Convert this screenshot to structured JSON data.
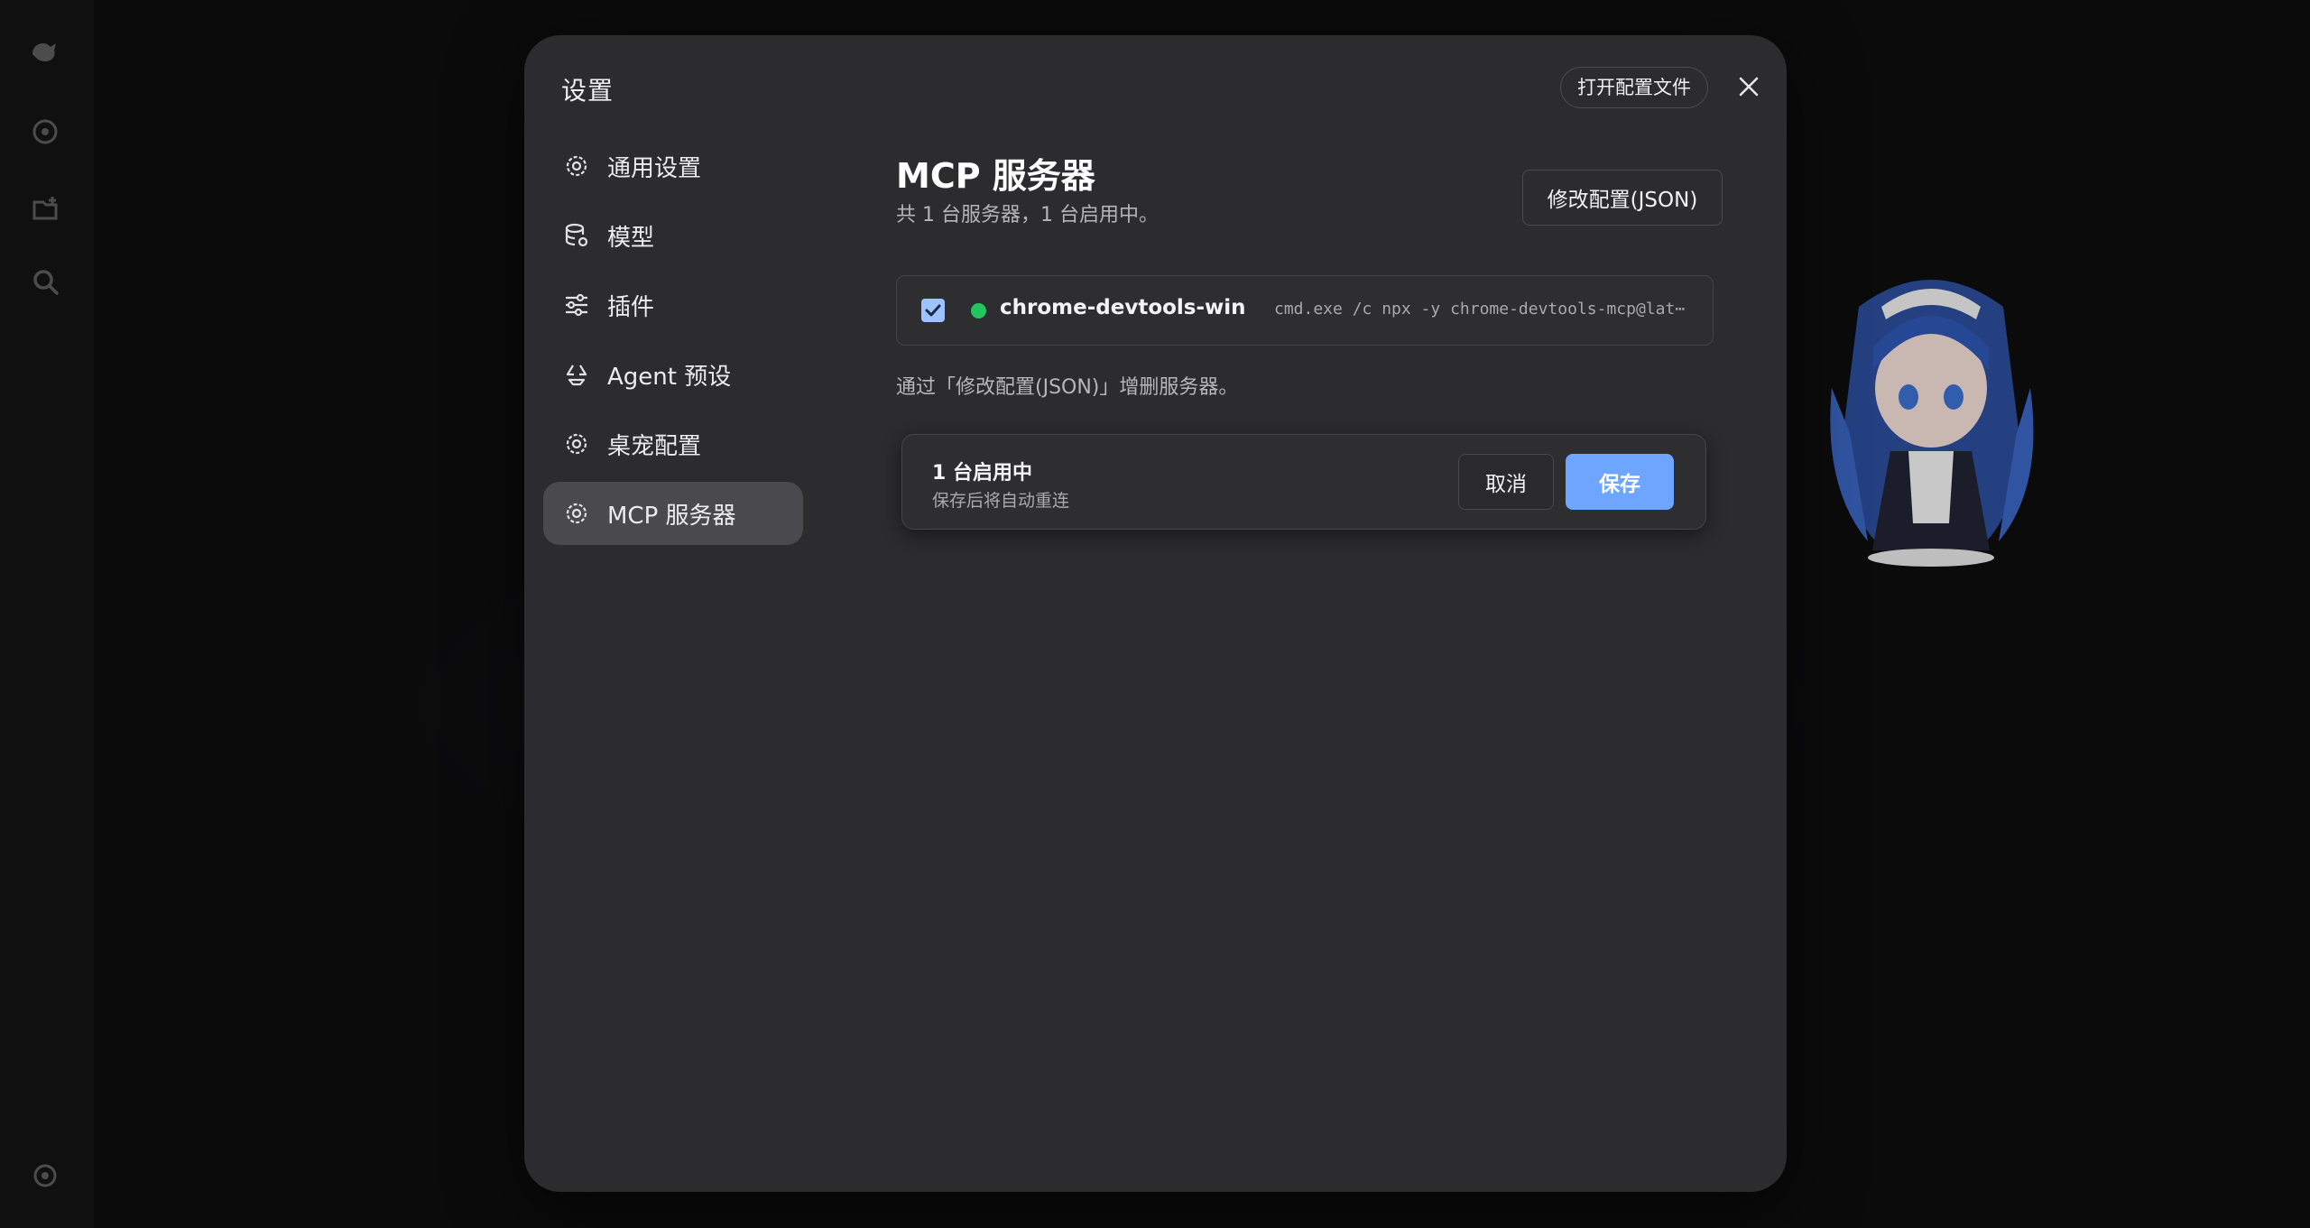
{
  "modal": {
    "title": "设置",
    "open_config_label": "打开配置文件"
  },
  "sidebar": {
    "items": [
      {
        "label": "通用设置",
        "icon": "gear-icon"
      },
      {
        "label": "模型",
        "icon": "database-icon"
      },
      {
        "label": "插件",
        "icon": "sliders-icon"
      },
      {
        "label": "Agent 预设",
        "icon": "recycle-icon"
      },
      {
        "label": "桌宠配置",
        "icon": "gear-icon"
      },
      {
        "label": "MCP 服务器",
        "icon": "gear-icon",
        "active": true
      }
    ]
  },
  "main": {
    "title": "MCP 服务器",
    "subtitle": "共 1 台服务器，1 台启用中。",
    "edit_json_label": "修改配置(JSON)",
    "servers": [
      {
        "name": "chrome-devtools-win",
        "command": "cmd.exe /c npx -y chrome-devtools-mcp@lat⋯",
        "enabled": true,
        "status_color": "#22c55e"
      }
    ],
    "hint": "通过「修改配置(JSON)」增删服务器。",
    "save_bar": {
      "count_text": "1 台启用中",
      "note": "保存后将自动重连",
      "cancel_label": "取消",
      "save_label": "保存"
    }
  },
  "colors": {
    "accent": "#6ea6ff",
    "status_ok": "#22c55e",
    "modal_bg": "#2c2c2f"
  }
}
